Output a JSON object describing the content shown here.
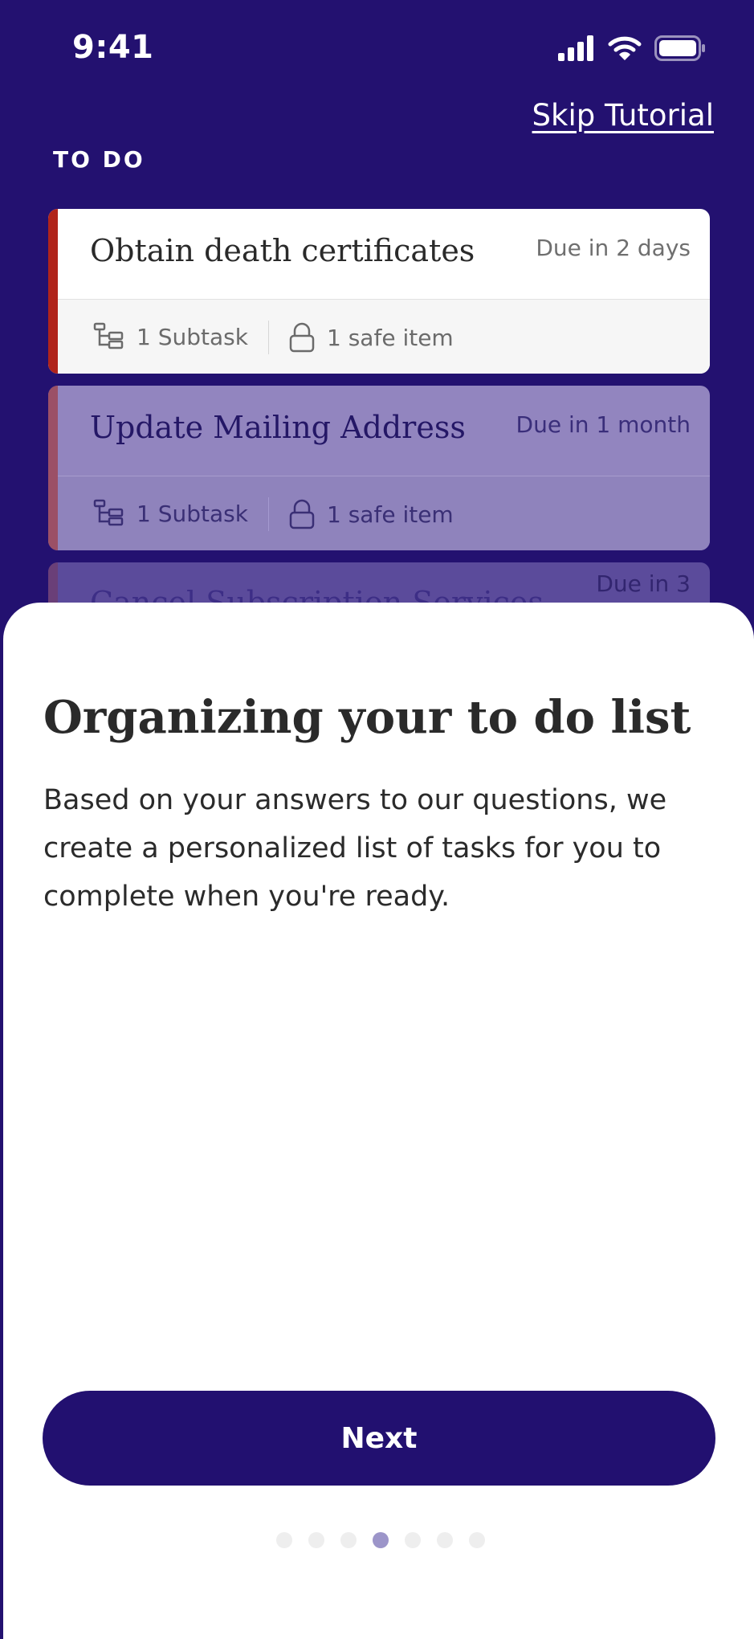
{
  "status_bar": {
    "time": "9:41"
  },
  "header": {
    "skip_label": "Skip Tutorial",
    "section_label": "TO DO"
  },
  "tasks": [
    {
      "title": "Obtain death certificates",
      "due": "Due in 2 days",
      "subtasks": "1 Subtask",
      "safe_items": "1 safe item"
    },
    {
      "title": "Update Mailing Address",
      "due": "Due in 1 month",
      "subtasks": "1 Subtask",
      "safe_items": "1 safe item"
    },
    {
      "title": "Cancel Subscription Services",
      "due": "Due in 3"
    }
  ],
  "sheet": {
    "title": "Organizing your to do list",
    "body": "Based on your answers to our questions, we create a personalized list of tasks for you to complete when you're ready.",
    "next_label": "Next"
  },
  "pagination": {
    "total": 7,
    "current": 4
  },
  "colors": {
    "primary": "#231170",
    "accent_red": "#B0241B",
    "dot_active": "#9C95C9",
    "dot_inactive": "#EEEEEE"
  },
  "icons": {
    "signal": "cellular-signal-icon",
    "wifi": "wifi-icon",
    "battery": "battery-icon",
    "subtask": "subtask-tree-icon",
    "lock": "lock-icon"
  }
}
